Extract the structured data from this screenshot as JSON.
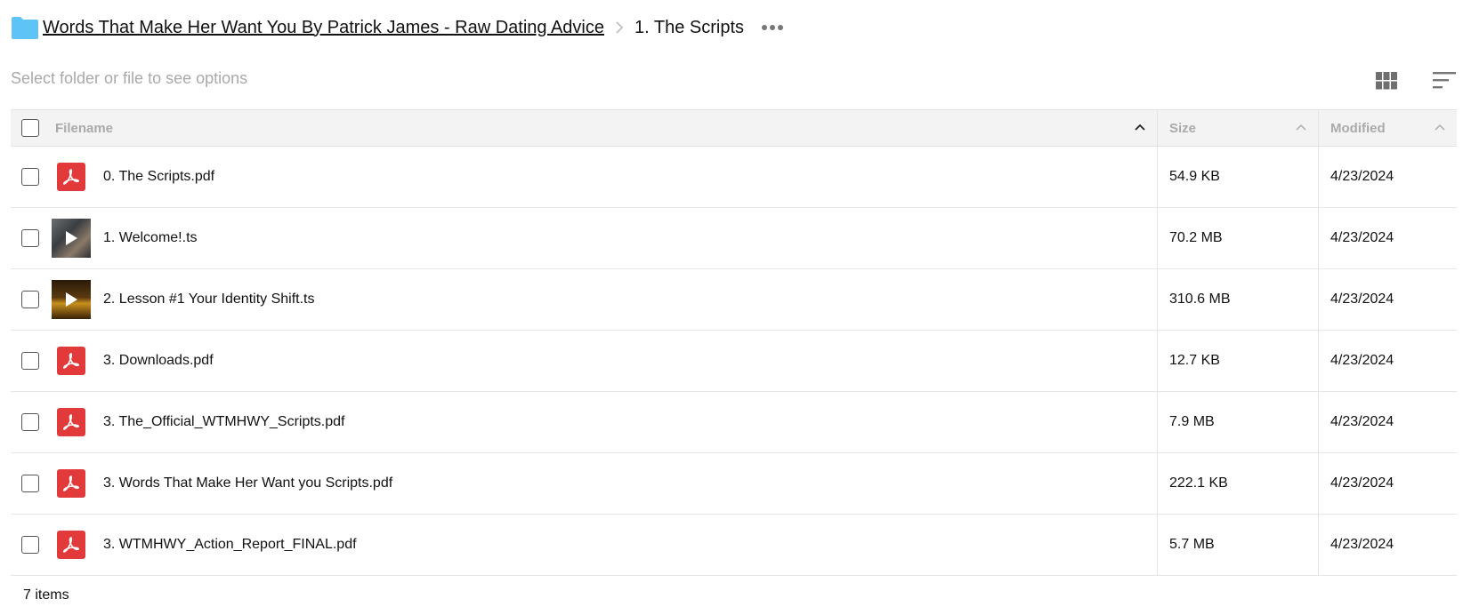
{
  "breadcrumb": {
    "folder_icon": "folder-icon",
    "parent": "Words That Make Her Want You By Patrick James - Raw Dating Advice",
    "current": "1. The Scripts",
    "more_icon": "more-horizontal-icon"
  },
  "toolbar": {
    "hint": "Select folder or file to see options",
    "view_icon": "grid-view-icon",
    "sort_icon": "sort-icon"
  },
  "table": {
    "headers": {
      "filename": "Filename",
      "size": "Size",
      "modified": "Modified"
    },
    "rows": [
      {
        "name": "0. The Scripts.pdf",
        "size": "54.9 KB",
        "modified": "4/23/2024",
        "icon": "pdf-icon"
      },
      {
        "name": "1. Welcome!.ts",
        "size": "70.2 MB",
        "modified": "4/23/2024",
        "icon": "video-thumbnail"
      },
      {
        "name": "2. Lesson #1 Your Identity Shift.ts",
        "size": "310.6 MB",
        "modified": "4/23/2024",
        "icon": "video-thumbnail"
      },
      {
        "name": "3. Downloads.pdf",
        "size": "12.7 KB",
        "modified": "4/23/2024",
        "icon": "pdf-icon"
      },
      {
        "name": "3. The_Official_WTMHWY_Scripts.pdf",
        "size": "7.9 MB",
        "modified": "4/23/2024",
        "icon": "pdf-icon"
      },
      {
        "name": "3. Words That Make Her Want you Scripts.pdf",
        "size": "222.1 KB",
        "modified": "4/23/2024",
        "icon": "pdf-icon"
      },
      {
        "name": "3. WTMHWY_Action_Report_FINAL.pdf",
        "size": "5.7 MB",
        "modified": "4/23/2024",
        "icon": "pdf-icon"
      }
    ]
  },
  "footer": {
    "count": "7 items"
  },
  "colors": {
    "folder": "#5ec4f7",
    "pdf": "#e2393a",
    "header_bg": "#f3f3f3",
    "muted_text": "#a9a9a9"
  }
}
